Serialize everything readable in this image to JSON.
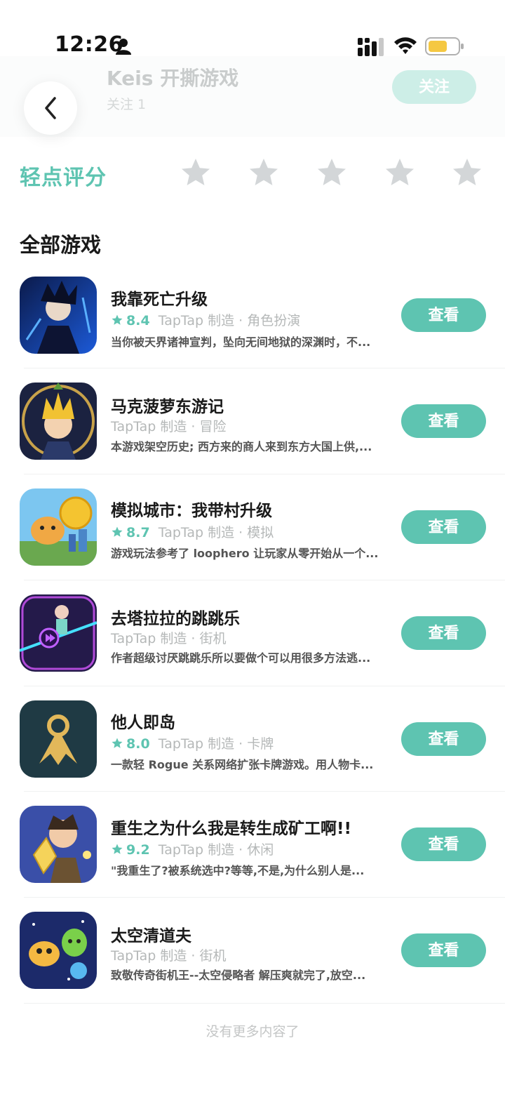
{
  "status_bar": {
    "time": "12:26"
  },
  "header": {
    "author_name": "Keis 开撕游戏",
    "follow_count": "关注 1",
    "follow_label": "关注"
  },
  "rating": {
    "label": "轻点评分"
  },
  "section": {
    "title": "全部游戏"
  },
  "games": [
    {
      "title": "我靠死亡升级",
      "score": "8.4",
      "maker": "TapTap 制造 · 角色扮演",
      "desc": "当你被天界诸神宣判，坠向无间地狱的深渊时，不...",
      "button": "查看"
    },
    {
      "title": "马克菠萝东游记",
      "score": "",
      "maker": "TapTap 制造 · 冒险",
      "desc": "本游戏架空历史; 西方来的商人来到东方大国上供,...",
      "button": "查看"
    },
    {
      "title": "模拟城市：我带村升级",
      "score": "8.7",
      "maker": "TapTap 制造 · 模拟",
      "desc": "游戏玩法参考了 loophero 让玩家从零开始从一个...",
      "button": "查看"
    },
    {
      "title": "去塔拉拉的跳跳乐",
      "score": "",
      "maker": "TapTap 制造 · 街机",
      "desc": "作者超级讨厌跳跳乐所以要做个可以用很多方法逃...",
      "button": "查看"
    },
    {
      "title": "他人即岛",
      "score": "8.0",
      "maker": "TapTap 制造 · 卡牌",
      "desc": "一款轻 Rogue 关系网络扩张卡牌游戏。用人物卡...",
      "button": "查看"
    },
    {
      "title": "重生之为什么我是转生成矿工啊!!",
      "score": "9.2",
      "maker": "TapTap 制造 · 休闲",
      "desc": "\"我重生了?被系统选中?等等,不是,为什么别人是...",
      "button": "查看"
    },
    {
      "title": "太空清道夫",
      "score": "",
      "maker": "TapTap 制造 · 街机",
      "desc": "致敬传奇街机王--太空侵略者 解压爽就完了,放空...",
      "button": "查看"
    }
  ],
  "footer": {
    "end_text": "没有更多内容了"
  },
  "colors": {
    "accent": "#5ec4b1",
    "star_empty": "#d3d6d8"
  }
}
